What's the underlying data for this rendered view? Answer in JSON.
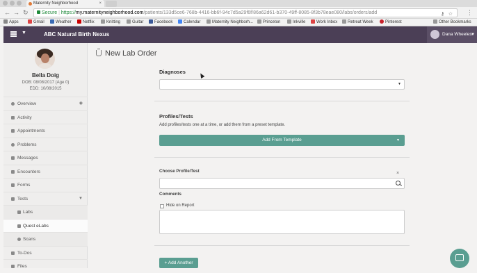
{
  "browser": {
    "tab_title": "Maternity Neighborhood",
    "tab_close": "×",
    "url_secure": "Secure",
    "url_scheme": "https://",
    "url_host": "my.maternityneighborhood.com",
    "url_path": "/patients/133d5ce6-768b-4416-bb6f-94c7d5a29f6f/86a62d61-b370-49ff-8085-8f3b78eae080/labs/orders/add",
    "bookmarks": [
      "Apps",
      "Gmail",
      "Weather",
      "Netflix",
      "Knitting",
      "Guitar",
      "Facebook",
      "Calendar",
      "Maternity Neighborh...",
      "Princeton",
      "Inkville",
      "Work Inbox",
      "Retreat Week",
      "Pinterest"
    ],
    "other_bookmarks": "Other Bookmarks"
  },
  "app": {
    "title": "ABC Natural Birth Nexus",
    "user_name": "Dana Wheeles"
  },
  "patient": {
    "name": "Bella Doig",
    "dob": "DOB: 08/08/2017 (Age 0)",
    "edd": "EDD: 10/08/2015"
  },
  "sidebar": {
    "items": [
      {
        "label": "Overview"
      },
      {
        "label": "Activity"
      },
      {
        "label": "Appointments"
      },
      {
        "label": "Problems"
      },
      {
        "label": "Messages"
      },
      {
        "label": "Encounters"
      },
      {
        "label": "Forms"
      },
      {
        "label": "Tests"
      },
      {
        "label": "Labs"
      },
      {
        "label": "Quest eLabs"
      },
      {
        "label": "Scans"
      },
      {
        "label": "To-Dos"
      },
      {
        "label": "Files"
      }
    ]
  },
  "form": {
    "page_title": "New Lab Order",
    "diagnoses_label": "Diagnoses",
    "profiles_heading": "Profiles/Tests",
    "profiles_help": "Add profiles/tests one at a time, or add them from a preset template.",
    "add_template_label": "Add From Template",
    "choose_profile_label": "Choose Profile/Test",
    "close_glyph": "×",
    "comments_label": "Comments",
    "hide_on_report_label": "Hide on Report",
    "add_another_label": "Add Another",
    "add_another_plus": "+"
  },
  "colors": {
    "header": "#4b3f56",
    "accent": "#5a9e91"
  }
}
